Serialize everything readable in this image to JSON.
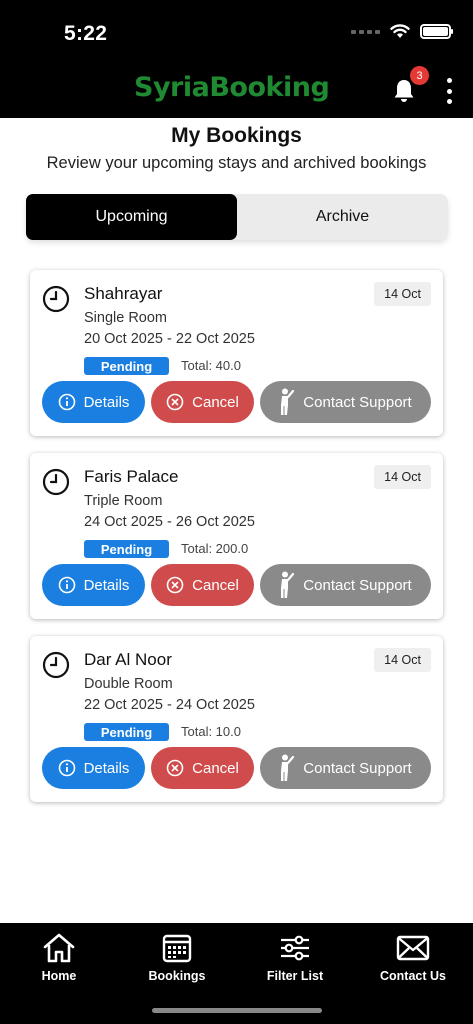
{
  "status_bar": {
    "time": "5:22"
  },
  "header": {
    "brand": "SyriaBooking",
    "notification_count": "3"
  },
  "page": {
    "title": "My Bookings",
    "subtitle": "Review your upcoming stays and archived bookings"
  },
  "tabs": [
    {
      "label": "Upcoming",
      "active": true
    },
    {
      "label": "Archive",
      "active": false
    }
  ],
  "bookings": [
    {
      "hotel": "Shahrayar",
      "room": "Single Room",
      "dates": "20 Oct 2025 - 22 Oct 2025",
      "booked_on": "14 Oct",
      "status": "Pending",
      "total": "Total: 40.0",
      "details_label": "Details",
      "cancel_label": "Cancel",
      "support_label": "Contact Support"
    },
    {
      "hotel": "Faris Palace",
      "room": "Triple Room",
      "dates": "24 Oct 2025 - 26 Oct 2025",
      "booked_on": "14 Oct",
      "status": "Pending",
      "total": "Total: 200.0",
      "details_label": "Details",
      "cancel_label": "Cancel",
      "support_label": "Contact Support"
    },
    {
      "hotel": "Dar Al Noor",
      "room": "Double Room",
      "dates": "22 Oct 2025 - 24 Oct 2025",
      "booked_on": "14 Oct",
      "status": "Pending",
      "total": "Total: 10.0",
      "details_label": "Details",
      "cancel_label": "Cancel",
      "support_label": "Contact Support"
    }
  ],
  "bottom_nav": [
    {
      "label": "Home",
      "icon": "home-icon"
    },
    {
      "label": "Bookings",
      "icon": "calendar-icon"
    },
    {
      "label": "Filter List",
      "icon": "sliders-icon"
    },
    {
      "label": "Contact Us",
      "icon": "mail-icon"
    }
  ],
  "colors": {
    "brand": "#1f8a32",
    "primary": "#1a7fe0",
    "danger": "#d04b4b",
    "neutral": "#8a8a8a",
    "badge": "#e53935"
  }
}
